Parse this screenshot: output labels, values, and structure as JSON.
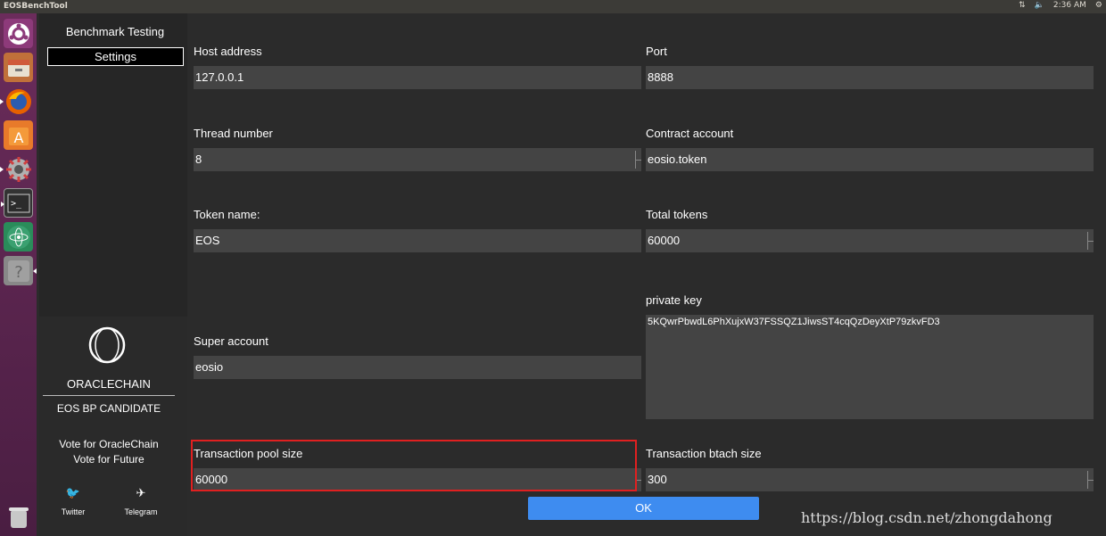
{
  "window": {
    "title": "EOSBenchTool",
    "time": "2:36 AM"
  },
  "sidebar": {
    "title": "Benchmark Testing",
    "active_item": "Settings"
  },
  "brand": {
    "name": "ORACLECHAIN",
    "subtitle": "EOS BP CANDIDATE",
    "vote_line1": "Vote for OracleChain",
    "vote_line2": "Vote for Future",
    "twitter_label": "Twitter",
    "telegram_label": "Telegram"
  },
  "form": {
    "host_label": "Host address",
    "host_value": "127.0.0.1",
    "port_label": "Port",
    "port_value": "8888",
    "thread_label": "Thread number",
    "thread_value": "8",
    "contract_label": "Contract account",
    "contract_value": "eosio.token",
    "token_label": "Token name:",
    "token_value": "EOS",
    "total_label": "Total tokens",
    "total_value": "60000",
    "privkey_label": "private key",
    "privkey_value": "5KQwrPbwdL6PhXujxW37FSSQZ1JiwsST4cqQzDeyXtP79zkvFD3",
    "super_label": "Super account",
    "super_value": "eosio",
    "pool_label": "Transaction pool size",
    "pool_value": "60000",
    "batch_label": "Transaction btach size",
    "batch_value": "300",
    "ok_label": "OK"
  },
  "watermark": "https://blog.csdn.net/zhongdahong",
  "colors": {
    "accent": "#3e8cf0",
    "highlight": "#e02020",
    "launcher": "#5e2750"
  }
}
